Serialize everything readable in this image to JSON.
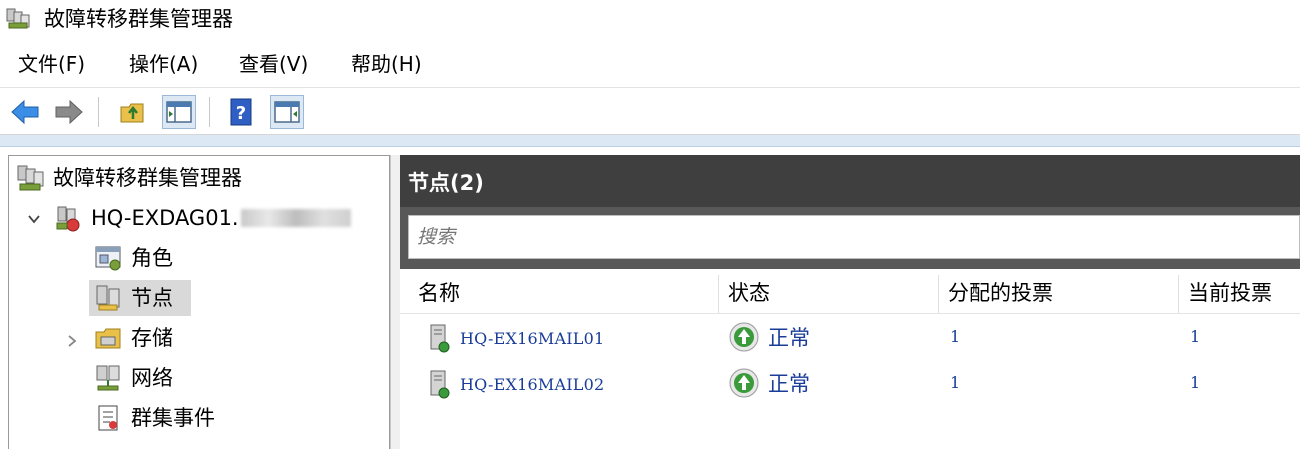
{
  "window": {
    "title": "故障转移群集管理器",
    "icon": "cluster-manager-icon"
  },
  "menu": [
    {
      "label": "文件(F)"
    },
    {
      "label": "操作(A)"
    },
    {
      "label": "查看(V)"
    },
    {
      "label": "帮助(H)"
    }
  ],
  "toolbar": {
    "buttons": [
      "back-arrow-icon",
      "forward-arrow-icon",
      "up-folder-icon",
      "show-hide-console-tree-icon",
      "help-icon",
      "show-hide-action-pane-icon"
    ]
  },
  "tree": {
    "root": {
      "label": "故障转移群集管理器",
      "icon": "cluster-manager-icon"
    },
    "cluster": {
      "label": "HQ-EXDAG01.",
      "icon": "cluster-icon"
    },
    "items": [
      {
        "label": "角色",
        "icon": "roles-icon"
      },
      {
        "label": "节点",
        "icon": "nodes-icon"
      },
      {
        "label": "存储",
        "icon": "storage-icon"
      },
      {
        "label": "网络",
        "icon": "network-icon"
      },
      {
        "label": "群集事件",
        "icon": "cluster-events-icon"
      }
    ]
  },
  "main": {
    "header_title": "节点(2)",
    "search_placeholder": "搜索",
    "columns": [
      "名称",
      "状态",
      "分配的投票",
      "当前投票"
    ],
    "rows": [
      {
        "name": "HQ-EX16MAIL01",
        "status": "正常",
        "assigned_votes": "1",
        "current_votes": "1"
      },
      {
        "name": "HQ-EX16MAIL02",
        "status": "正常",
        "assigned_votes": "1",
        "current_votes": "1"
      }
    ]
  },
  "colors": {
    "link_blue": "#1a3d99",
    "header_dark": "#3f3f3f",
    "search_band": "#585858",
    "selection": "#d9d9d9",
    "status_green": "#3b9a3b"
  }
}
